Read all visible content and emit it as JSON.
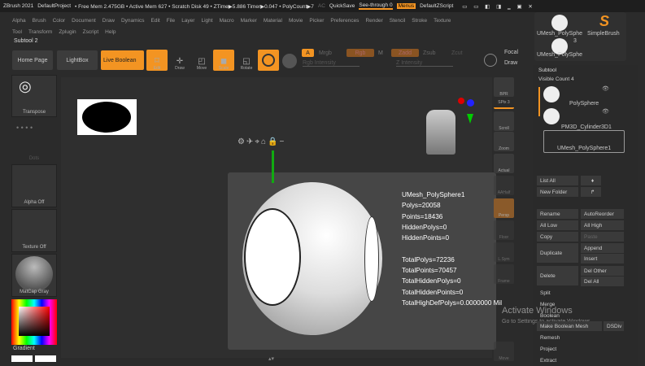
{
  "titlebar": {
    "app": "ZBrush 2021",
    "project": "DefaultProject",
    "stats": "• Free Mem 2.475GB • Active Mem 627 • Scratch Disk 49 • ZTime▶5.886 Timer▶0.047 • PolyCount▶7",
    "ac": "AC",
    "quicksave": "QuickSave",
    "seethrough": "See-through  0",
    "menus": "Menus",
    "script": "DefaultZScript"
  },
  "menu1": [
    "Alpha",
    "Brush",
    "Color",
    "Document",
    "Draw",
    "Dynamics",
    "Edit",
    "File",
    "Layer",
    "Light",
    "Macro",
    "Marker",
    "Material",
    "Movie",
    "Picker",
    "Preferences",
    "Render",
    "Stencil",
    "Stroke",
    "Texture"
  ],
  "menu2": [
    "Tool",
    "Transform",
    "Zplugin",
    "Zscript",
    "Help"
  ],
  "subtool_title": "Subtool 2",
  "toolbar": {
    "home": "Home Page",
    "lightbox": "LightBox",
    "live_boolean": "Live Boolean",
    "edit": "Edit",
    "draw": "Draw",
    "move": "Move",
    "scale": "Scale",
    "rotate": "Rotate",
    "a": "A",
    "mrgb": "Mrgb",
    "rgb": "Rgb",
    "m": "M",
    "zadd": "Zadd",
    "zsub": "Zsub",
    "zcut": "Zcut",
    "rgb_intensity": "Rgb Intensity",
    "z_intensity": "Z Intensity",
    "focal": "Focal",
    "draw2": "Draw"
  },
  "left_shelf": {
    "transpose": "Transpose",
    "dots": "Dots",
    "alpha": "Alpha Off",
    "texture": "Texture Off",
    "matcap": "MatCap Gray",
    "gradient": "Gradient"
  },
  "right_shelf": [
    "BPR",
    "SPix 3",
    "Scroll",
    "Zoom",
    "Actual",
    "AAHalf",
    "Persp",
    "Floor",
    "L.Sym",
    "Frame",
    "Move"
  ],
  "info": {
    "name": "UMesh_PolySphere1",
    "polys": "Polys=20058",
    "points": "Points=18436",
    "hiddenpolys": "HiddenPolys=0",
    "hiddenpoints": "HiddenPoints=0",
    "totalpolys": "TotalPolys=72236",
    "totalpoints": "TotalPoints=70457",
    "totalhiddenpolys": "TotalHiddenPolys=0",
    "totalhiddenpoints": "TotalHiddenPoints=0",
    "totalhighdef": "TotalHighDefPolys=0.0000000 Mil"
  },
  "tool_thumbs": {
    "t1": "UMesh_PolySphe",
    "t2": "SimpleBrush",
    "t3": "UMesh_PolySphe",
    "count": "3"
  },
  "subtool": {
    "header": "Subtool",
    "visible_count": "Visible Count 4",
    "items": [
      "PolySphere",
      "PM3D_Cylinder3D1",
      "UMesh_PolySphere1"
    ]
  },
  "buttons": {
    "list_all": "List All",
    "new_folder": "New Folder",
    "rename": "Rename",
    "autoreorder": "AutoReorder",
    "all_low": "All Low",
    "all_high": "All High",
    "copy": "Copy",
    "paste": "Paste",
    "duplicate": "Duplicate",
    "append": "Append",
    "insert": "Insert",
    "delete": "Delete",
    "del_other": "Del Other",
    "del_all": "Del All",
    "split": "Split",
    "merge": "Merge",
    "boolean": "Boolean",
    "make_boolean": "Make Boolean Mesh",
    "dsdiv": "DSDiv",
    "remesh": "Remesh",
    "project": "Project",
    "extract": "Extract"
  },
  "watermark": {
    "l1": "Activate Windows",
    "l2": "Go to Settings to activate Windows."
  }
}
